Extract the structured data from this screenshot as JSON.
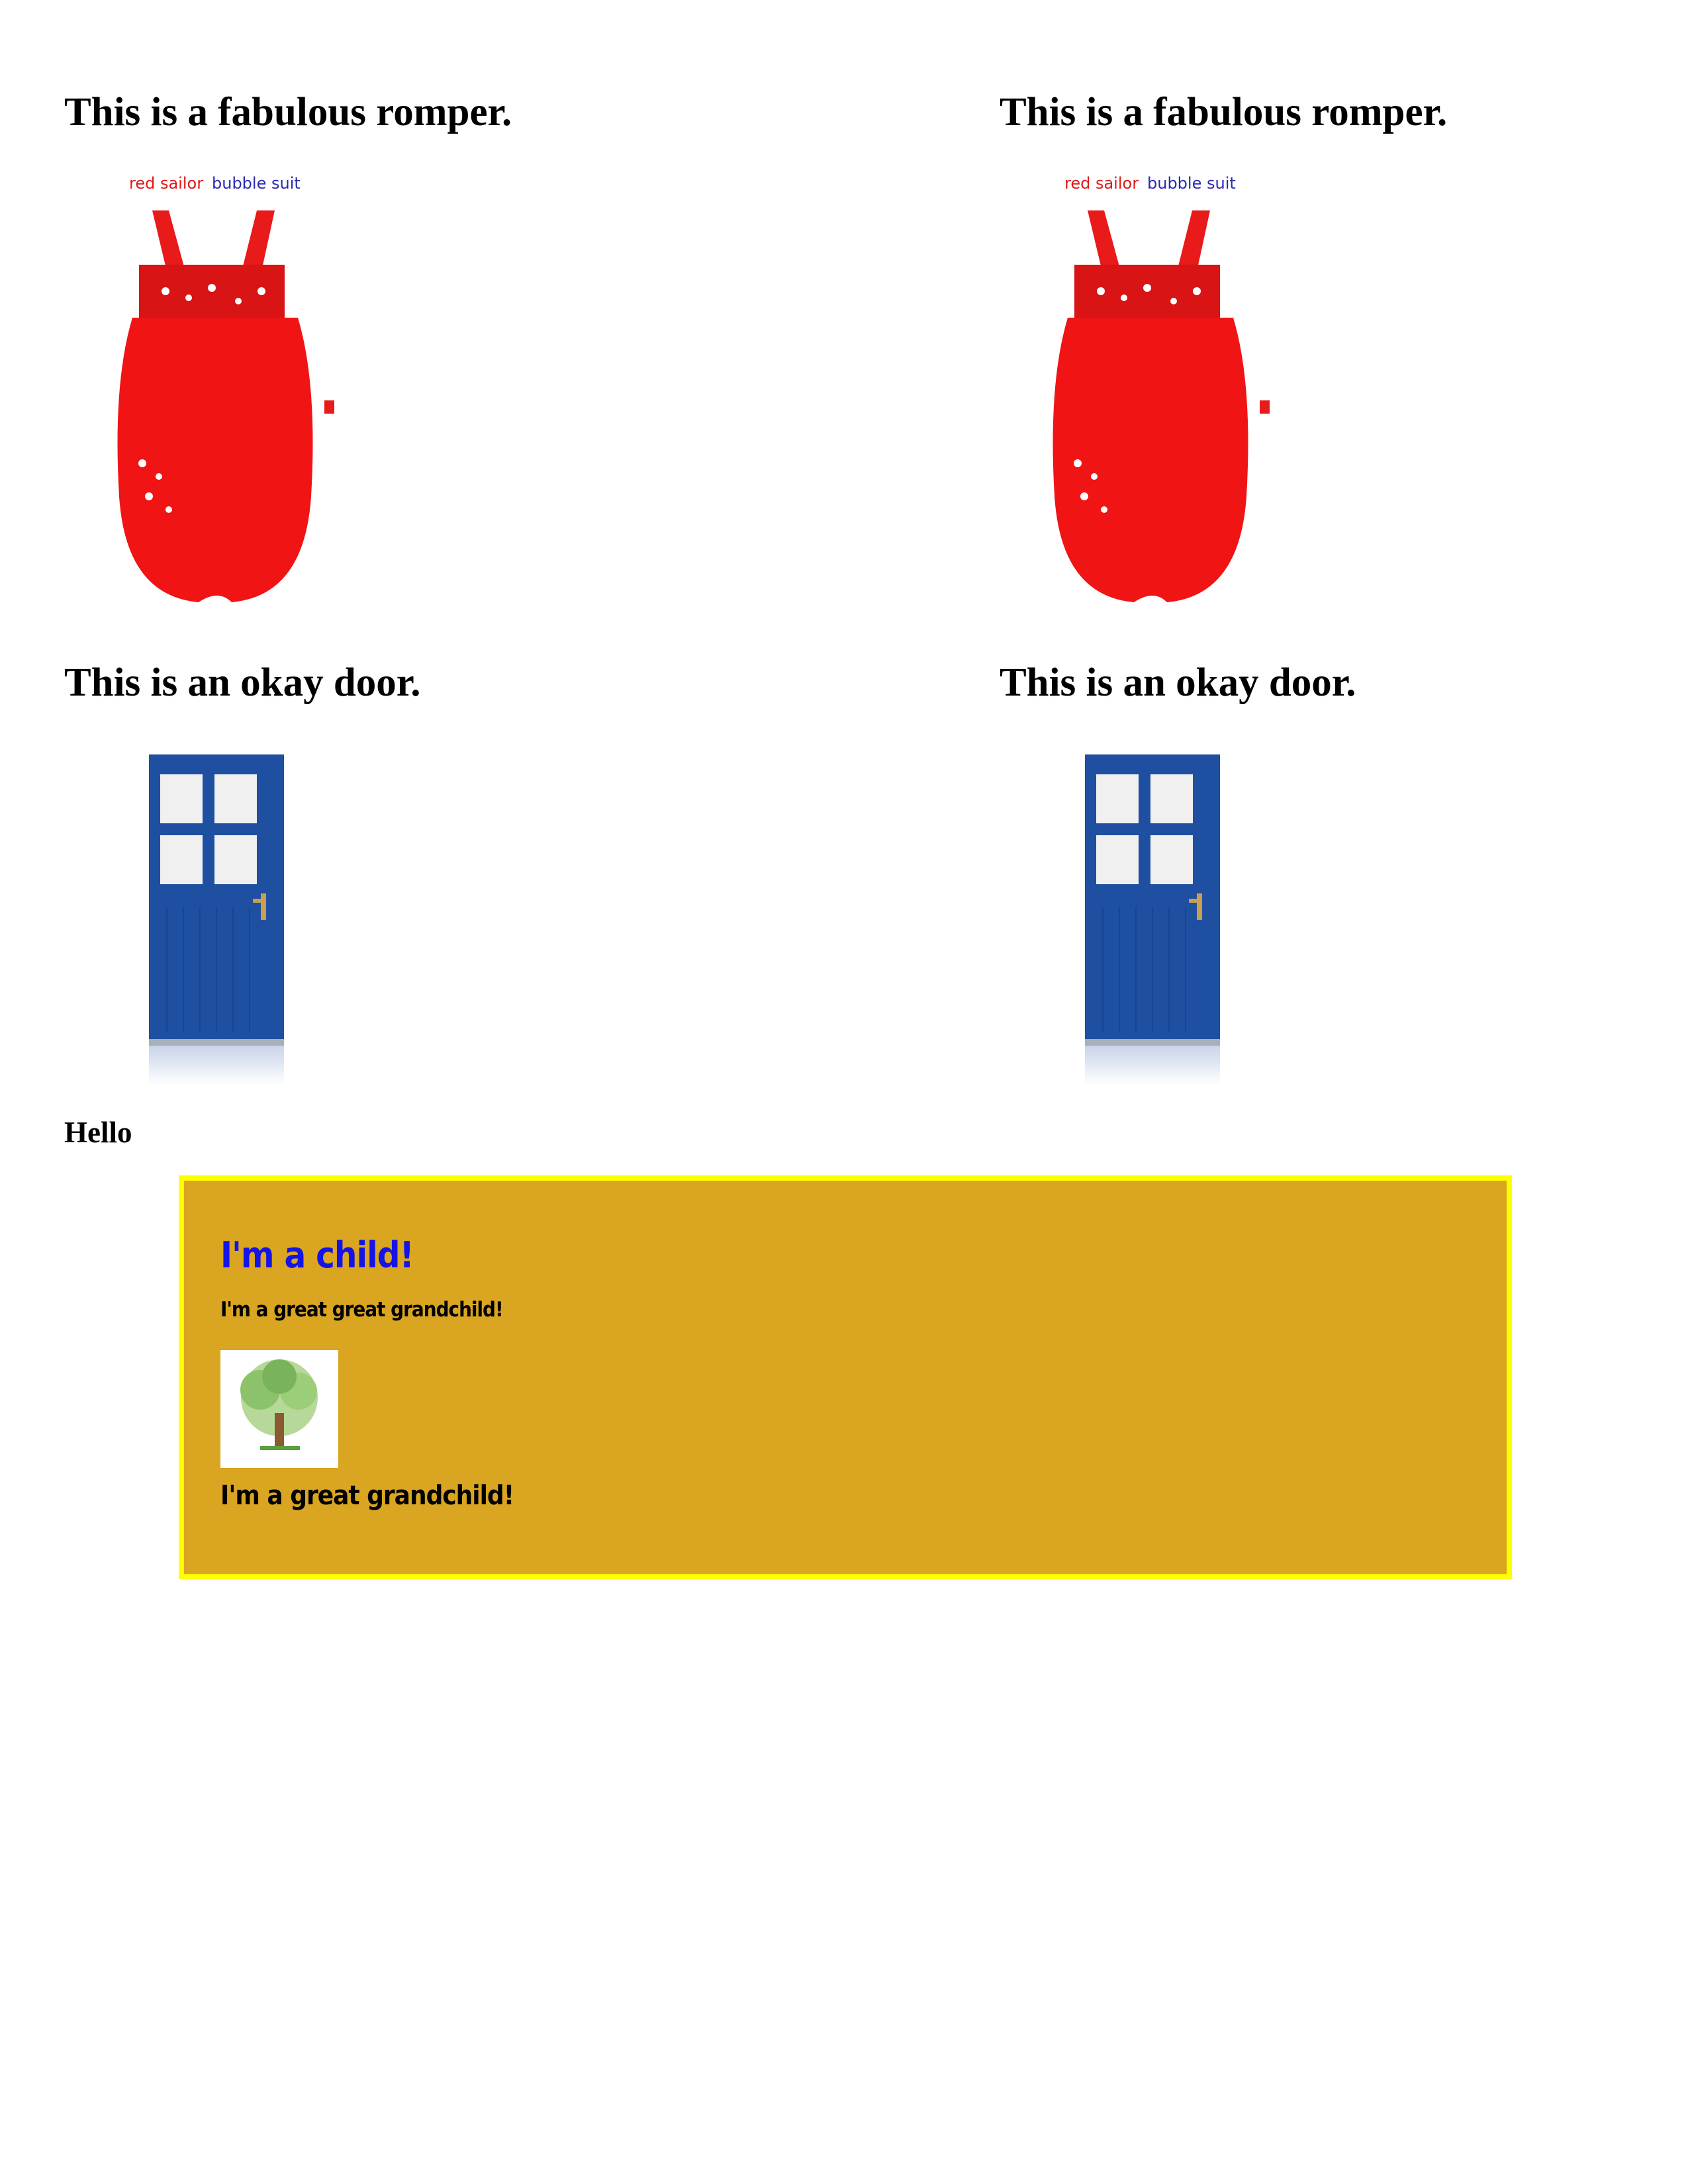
{
  "left_column": {
    "romper_heading": "This is a fabulous romper.",
    "romper_image_text_red": "red sailor",
    "romper_image_text_blue": "bubble suit",
    "door_heading": "This is an okay door."
  },
  "right_column": {
    "romper_heading": "This is a fabulous romper.",
    "romper_image_text_red": "red sailor",
    "romper_image_text_blue": "bubble suit",
    "door_heading": "This is an okay door."
  },
  "hello_text": "Hello",
  "child_box": {
    "title": "I'm a child!",
    "great_great_grandchild": "I'm a great great grandchild!",
    "great_grandchild": "I'm a great grandchild!",
    "background_color": "#daa520",
    "border_color": "#ffff00",
    "title_color": "#1414e6"
  },
  "colors": {
    "romper_red": "#f01010",
    "door_blue": "#1f4fa0"
  }
}
